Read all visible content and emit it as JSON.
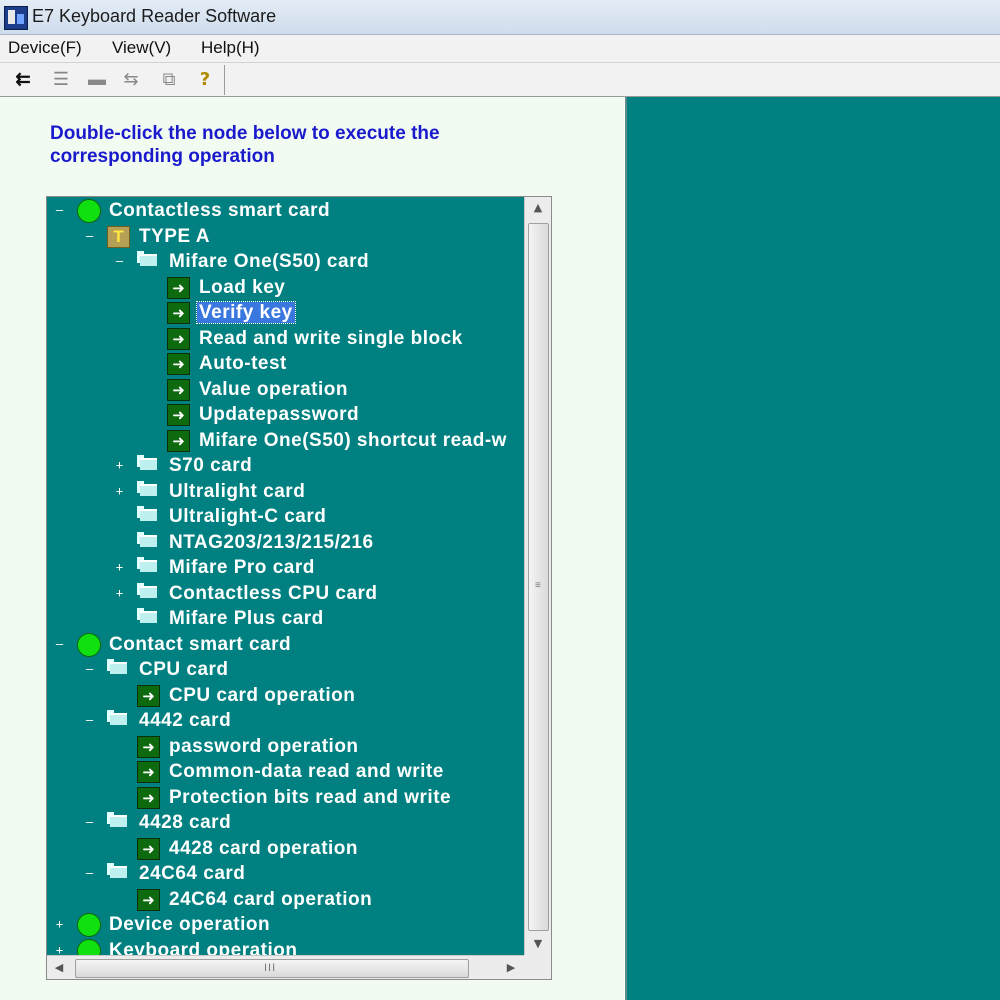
{
  "window": {
    "title": "E7 Keyboard Reader Software"
  },
  "menu": [
    {
      "label": "Device(F)"
    },
    {
      "label": "View(V)"
    },
    {
      "label": "Help(H)"
    }
  ],
  "toolbar": {
    "icons": [
      "usb-connect-icon",
      "list-icon",
      "card-icon",
      "usb-disconnect-icon",
      "copy-window-icon",
      "help-icon"
    ]
  },
  "instruction": "Double-click the node below to execute the corresponding operation",
  "tree": {
    "selected": "Verify key",
    "nodes": [
      {
        "label": "Contactless smart card",
        "level": 0,
        "icon": "circle",
        "toggle": "-"
      },
      {
        "label": "TYPE A",
        "level": 1,
        "icon": "t",
        "toggle": "-"
      },
      {
        "label": "Mifare One(S50) card",
        "level": 2,
        "icon": "folder",
        "toggle": "-"
      },
      {
        "label": "Load key",
        "level": 3,
        "icon": "arrow",
        "toggle": ""
      },
      {
        "label": "Verify key",
        "level": 3,
        "icon": "arrow",
        "toggle": ""
      },
      {
        "label": "Read and write single block",
        "level": 3,
        "icon": "arrow",
        "toggle": ""
      },
      {
        "label": "Auto-test",
        "level": 3,
        "icon": "arrow",
        "toggle": ""
      },
      {
        "label": "Value operation",
        "level": 3,
        "icon": "arrow",
        "toggle": ""
      },
      {
        "label": "Updatepassword",
        "level": 3,
        "icon": "arrow",
        "toggle": ""
      },
      {
        "label": "Mifare One(S50) shortcut read-w",
        "level": 3,
        "icon": "arrow",
        "toggle": ""
      },
      {
        "label": "S70  card",
        "level": 2,
        "icon": "folder",
        "toggle": "+"
      },
      {
        "label": "Ultralight card",
        "level": 2,
        "icon": "folder",
        "toggle": "+"
      },
      {
        "label": "Ultralight-C card",
        "level": 2,
        "icon": "folder",
        "toggle": ""
      },
      {
        "label": "NTAG203/213/215/216",
        "level": 2,
        "icon": "folder",
        "toggle": ""
      },
      {
        "label": "Mifare Pro  card",
        "level": 2,
        "icon": "folder",
        "toggle": "+"
      },
      {
        "label": "Contactless CPU card",
        "level": 2,
        "icon": "folder",
        "toggle": "+"
      },
      {
        "label": "Mifare Plus card",
        "level": 2,
        "icon": "folder",
        "toggle": ""
      },
      {
        "label": "Contact smart card",
        "level": 0,
        "icon": "circle",
        "toggle": "-"
      },
      {
        "label": "CPU card",
        "level": 1,
        "icon": "folder",
        "toggle": "-"
      },
      {
        "label": "CPU card  operation",
        "level": 2,
        "icon": "arrow",
        "toggle": ""
      },
      {
        "label": "4442 card",
        "level": 1,
        "icon": "folder",
        "toggle": "-"
      },
      {
        "label": "password operation",
        "level": 2,
        "icon": "arrow",
        "toggle": ""
      },
      {
        "label": "Common-data read and write",
        "level": 2,
        "icon": "arrow",
        "toggle": ""
      },
      {
        "label": "Protection bits read and write",
        "level": 2,
        "icon": "arrow",
        "toggle": ""
      },
      {
        "label": "4428 card",
        "level": 1,
        "icon": "folder",
        "toggle": "-"
      },
      {
        "label": "4428 card  operation",
        "level": 2,
        "icon": "arrow",
        "toggle": ""
      },
      {
        "label": "24C64 card",
        "level": 1,
        "icon": "folder",
        "toggle": "-"
      },
      {
        "label": "24C64 card  operation",
        "level": 2,
        "icon": "arrow",
        "toggle": ""
      },
      {
        "label": "Device operation",
        "level": 0,
        "icon": "circle",
        "toggle": "+"
      },
      {
        "label": "Keyboard operation",
        "level": 0,
        "icon": "circle",
        "toggle": "+"
      }
    ]
  },
  "scrollbar": {
    "h_grip": "III"
  },
  "colors": {
    "tree_bg": "#008080",
    "right_pane_bg": "#008080",
    "instruction": "#1a1acc",
    "selection": "#3a78e0"
  }
}
